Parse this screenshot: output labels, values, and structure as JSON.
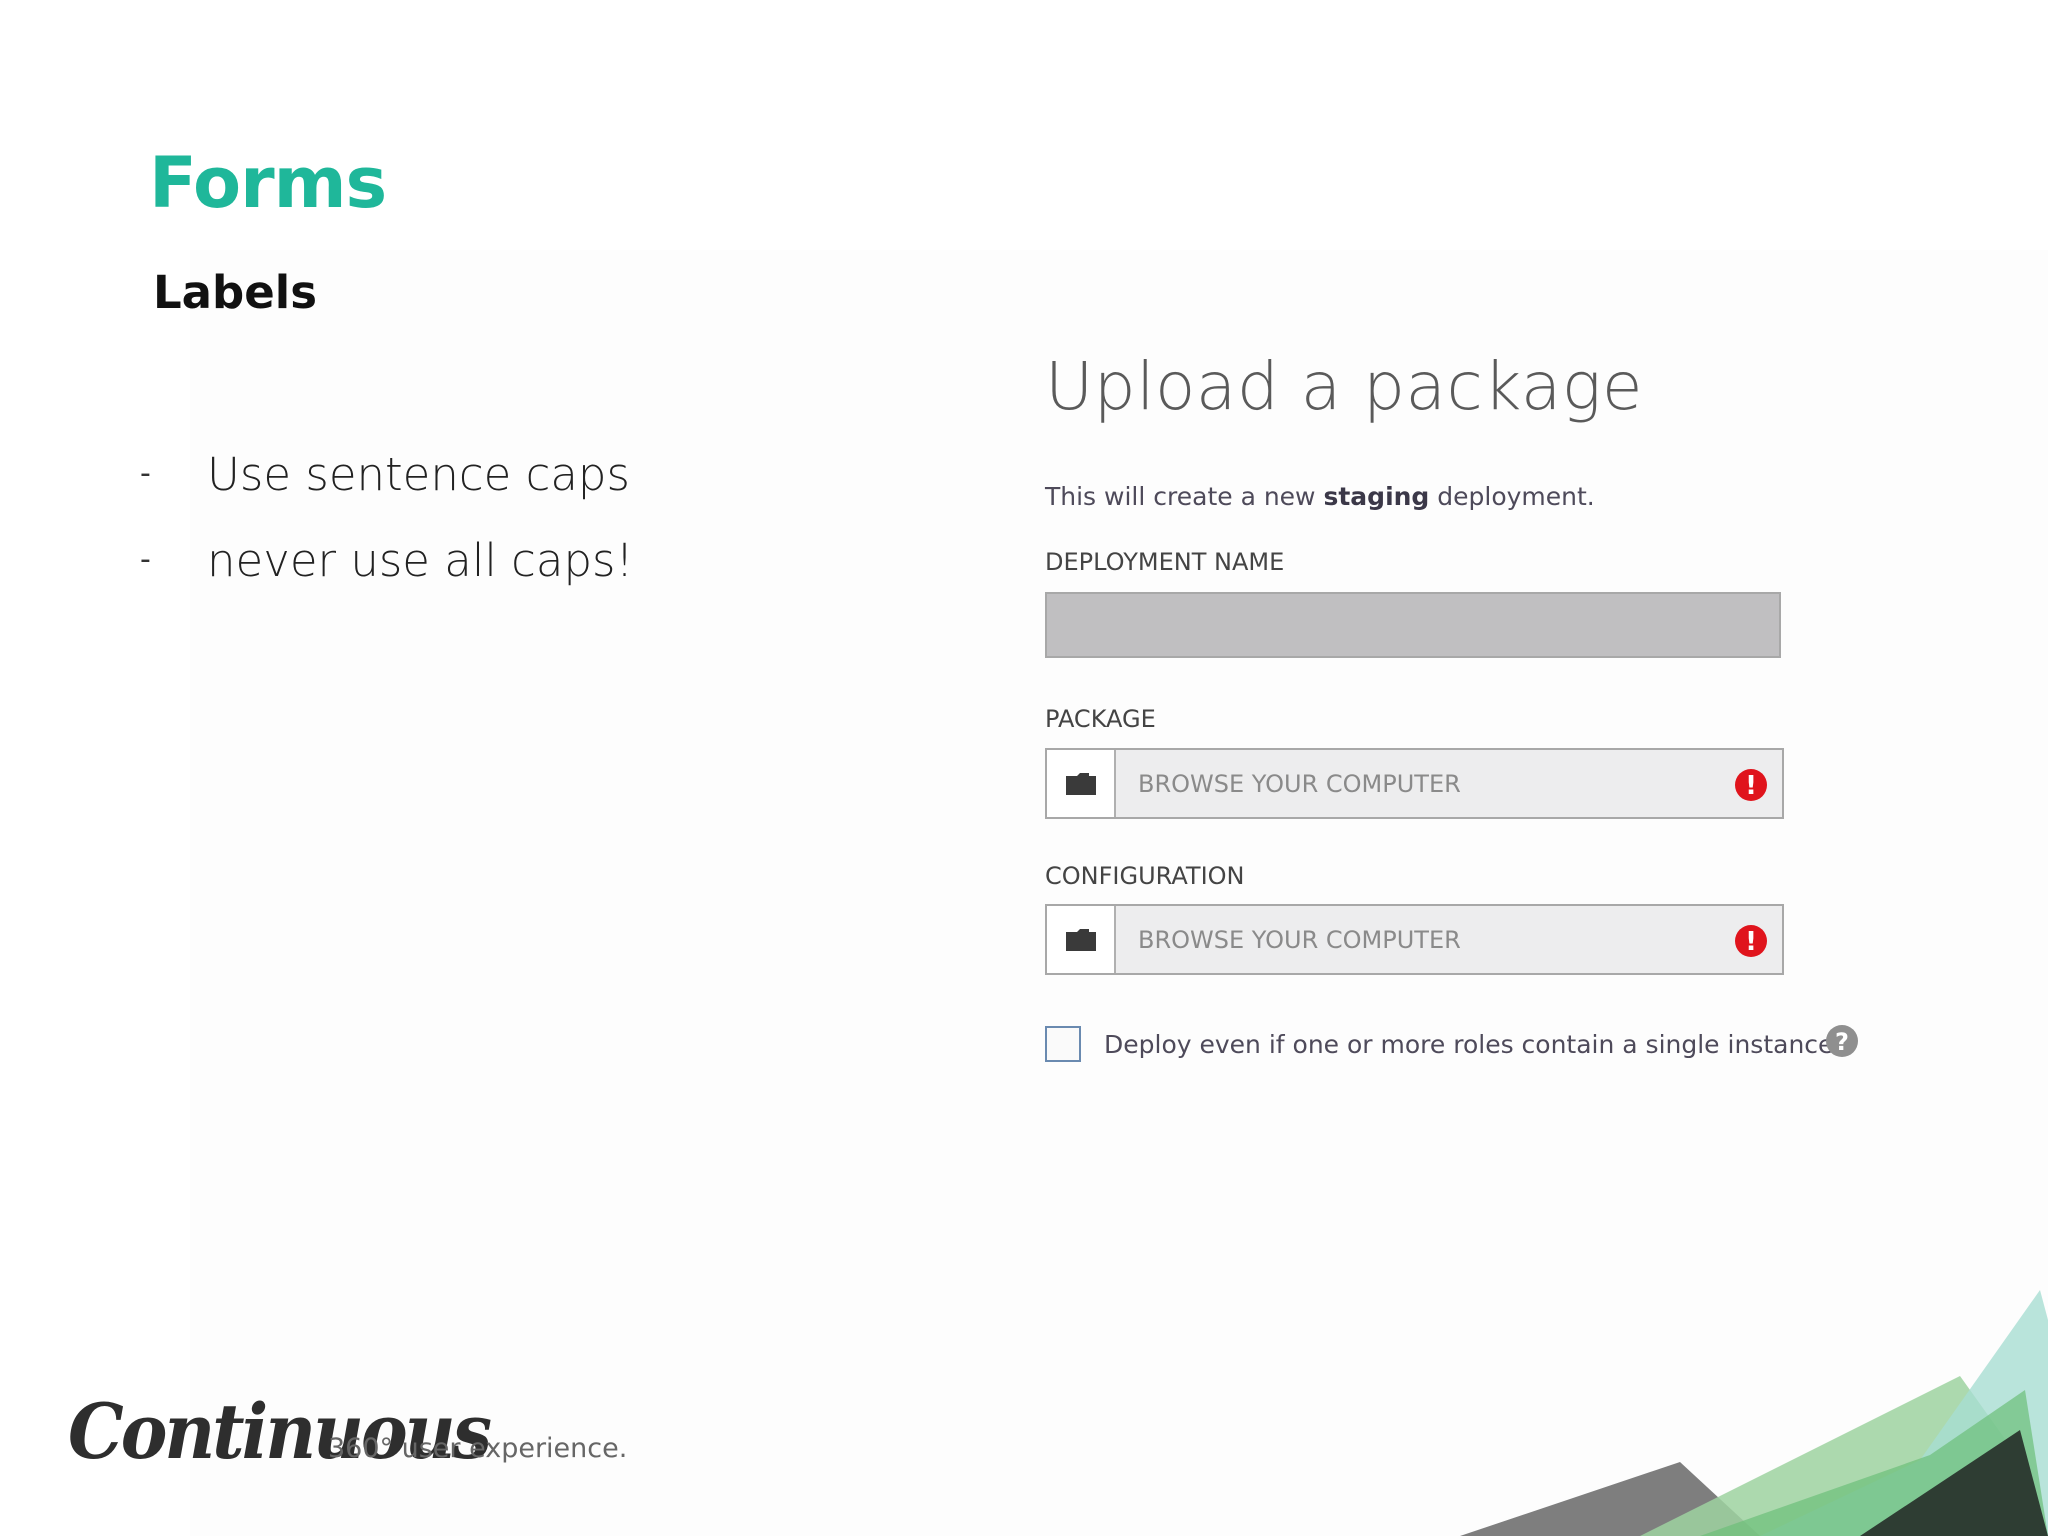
{
  "slide": {
    "title": "Forms",
    "subtitle": "Labels",
    "bullets": [
      {
        "dash": "-",
        "text": "Use sentence caps"
      },
      {
        "dash": "-",
        "text": "never use all caps!"
      }
    ]
  },
  "form": {
    "title": "Upload a package",
    "intro_before": "This will create a new ",
    "intro_bold": "staging",
    "intro_after": " deployment.",
    "deployment_name_label": "DEPLOYMENT NAME",
    "deployment_name_value": "",
    "package_label": "PACKAGE",
    "package_placeholder": "BROWSE YOUR COMPUTER",
    "configuration_label": "CONFIGURATION",
    "configuration_placeholder": "BROWSE YOUR COMPUTER",
    "checkbox_label": "Deploy even if one or more roles contain a single instance",
    "checkbox_checked": false,
    "error_mark": "!",
    "help_mark": "?"
  },
  "footer": {
    "logo": "Continuous",
    "tagline": "360° user experience."
  },
  "colors": {
    "accent": "#1fb79a",
    "error": "#e0141c",
    "help": "#8f8f8f"
  }
}
